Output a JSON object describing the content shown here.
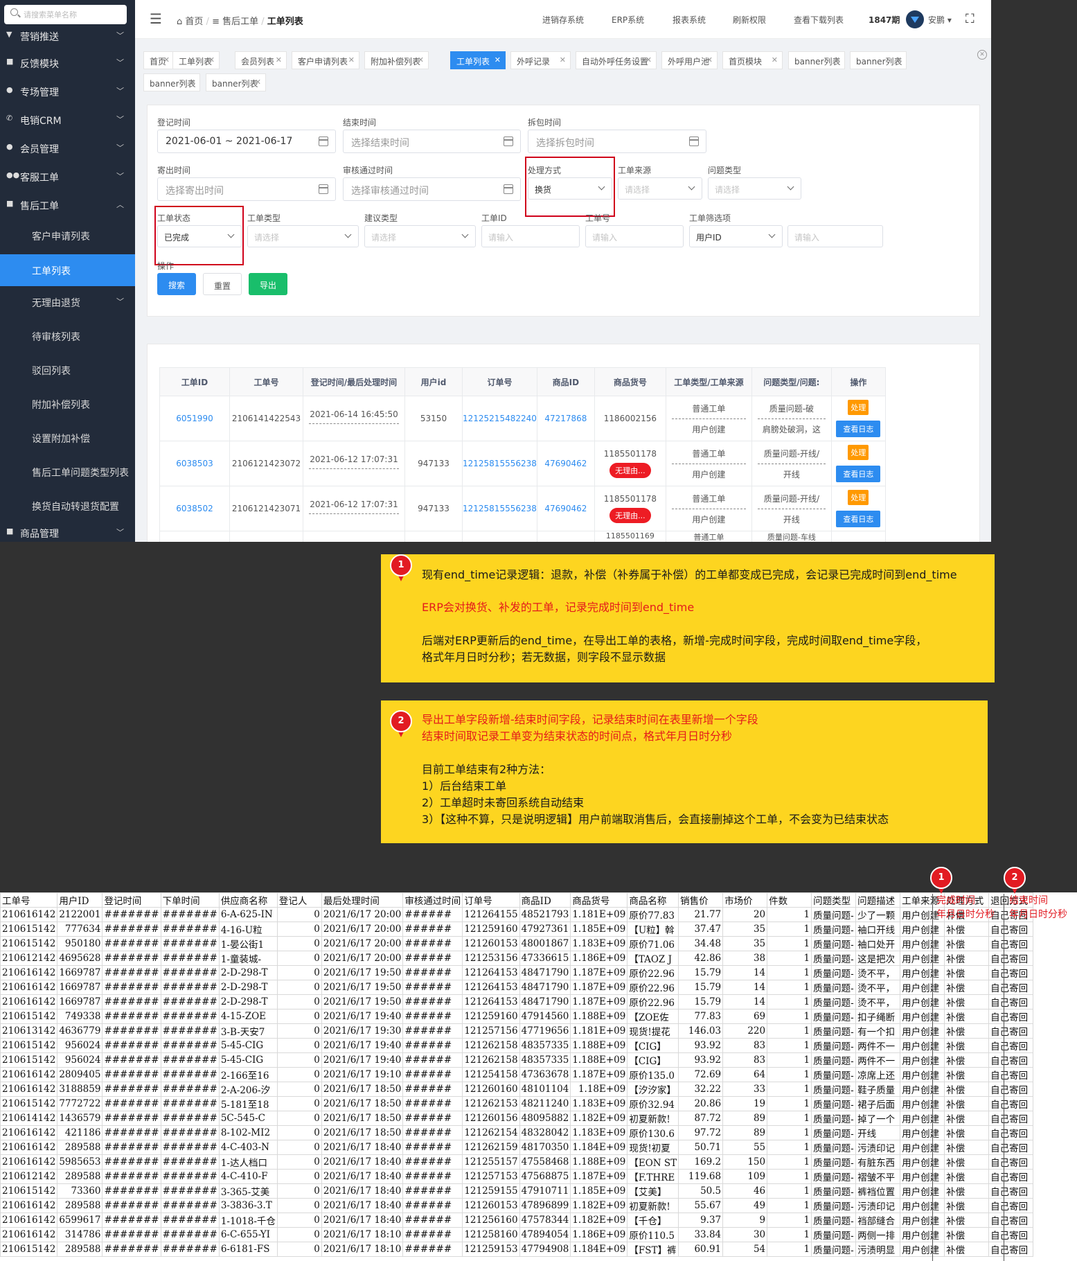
{
  "sidebar": {
    "search_placeholder": "请搜索菜单名称",
    "items": [
      {
        "label": "营销推送",
        "icon": "megaphone-icon"
      },
      {
        "label": "反馈模块",
        "icon": "lock-icon"
      },
      {
        "label": "专场管理",
        "icon": "pin-icon"
      },
      {
        "label": "电销CRM",
        "icon": "phone-icon"
      },
      {
        "label": "会员管理",
        "icon": "user-icon"
      },
      {
        "label": "客服工单",
        "icon": "users-icon"
      },
      {
        "label": "售后工单",
        "icon": "folder-icon"
      }
    ],
    "subitems": [
      "客户申请列表",
      "工单列表",
      "无理由退货",
      "待审核列表",
      "驳回列表",
      "附加补偿列表",
      "设置附加补偿",
      "售后工单问题类型列表",
      "换货自动转退货配置"
    ],
    "last_item": "商品管理"
  },
  "topbar": {
    "breadcrumb": [
      "首页",
      "售后工单",
      "工单列表"
    ],
    "nav": [
      "进销存系统",
      "ERP系统",
      "报表系统",
      "刷新权限",
      "查看下载列表",
      "1847期"
    ],
    "user": "安鹏"
  },
  "tabs": [
    "首页",
    "工单列表",
    "会员列表",
    "客户申请列表",
    "附加补偿列表",
    "工单列表",
    "外呼记录",
    "自动外呼任务设置",
    "外呼用户池",
    "首页模块",
    "banner列表",
    "banner列表",
    "banner列表",
    "banner列表"
  ],
  "filters": {
    "reg_time_label": "登记时间",
    "reg_time_value": "2021-06-01 ~ 2021-06-17",
    "end_time_label": "结束时间",
    "end_time_ph": "选择结束时间",
    "unpack_label": "拆包时间",
    "unpack_ph": "选择拆包时间",
    "ship_label": "寄出时间",
    "ship_ph": "选择寄出时间",
    "audit_label": "审核通过时间",
    "audit_ph": "选择审核通过时间",
    "method_label": "处理方式",
    "method_value": "换货",
    "source_label": "工单来源",
    "source_ph": "请选择",
    "problem_label": "问题类型",
    "problem_ph": "请选择",
    "status_label": "工单状态",
    "status_value": "已完成",
    "type_label": "工单类型",
    "type_ph": "请选择",
    "suggest_label": "建议类型",
    "suggest_ph": "请选择",
    "id_label": "工单ID",
    "id_ph": "请输入",
    "no_label": "工单号",
    "no_ph": "请输入",
    "filter_label": "工单筛选项",
    "filter_value": "用户ID",
    "filter_ph": "请输入",
    "ops_label": "操作",
    "search": "搜索",
    "reset": "重置",
    "export": "导出"
  },
  "table": {
    "headers": [
      "工单ID",
      "工单号",
      "登记时间/最后处理时间",
      "用户id",
      "订单号",
      "商品ID",
      "商品货号",
      "工单类型/工单来源",
      "问题类型/问题:",
      "操作"
    ],
    "rows": [
      {
        "id": "6051990",
        "no": "2106141422543",
        "time": "2021-06-14 16:45:50",
        "uid": "53150",
        "order": "12125215482240",
        "goods": "47217868",
        "sku": "1186002156",
        "badge": "",
        "type": "普通工单",
        "source": "用户创建",
        "problem": "质量问题-破",
        "problem2": "肩膀处破洞，这"
      },
      {
        "id": "6038503",
        "no": "2106121423072",
        "time": "2021-06-12 17:07:31",
        "uid": "947133",
        "order": "12125815556238",
        "goods": "47690462",
        "sku": "1185501178",
        "badge": "无理由...",
        "type": "普通工单",
        "source": "用户创建",
        "problem": "质量问题-开线/",
        "problem2": "开线"
      },
      {
        "id": "6038502",
        "no": "2106121423071",
        "time": "2021-06-12 17:07:31",
        "uid": "947133",
        "order": "12125815556238",
        "goods": "47690462",
        "sku": "1185501178",
        "badge": "无理由...",
        "type": "普通工单",
        "source": "用户创建",
        "problem": "质量问题-开线/",
        "problem2": "开线"
      }
    ],
    "partial_row": {
      "sku": "1185501169",
      "type": "普通工单",
      "problem": "质量问题-车线"
    },
    "btn_handle": "处理",
    "btn_log": "查看日志"
  },
  "note1": {
    "num": "1",
    "l1": "现有end_time记录逻辑：退款，补偿（补券属于补偿）的工单都变成已完成，会记录已完成时间到end_time",
    "l2": "ERP会对换货、补发的工单，记录完成时间到end_time",
    "l3": "后端对ERP更新后的end_time，在导出工单的表格，新增-完成时间字段，完成时间取end_time字段，",
    "l4": "格式年月日时分秒；若无数据，则字段不显示数据"
  },
  "note2": {
    "num": "2",
    "l1": "导出工单字段新增-结束时间字段，记录结束时间在表里新增一个字段",
    "l2": "结束时间取记录工单变为结束状态的时间点，格式年月日时分秒",
    "l3": "目前工单结束有2种方法：",
    "l4": "1）后台结束工单",
    "l5": "2）工单超时未寄回系统自动结束",
    "l6": "3）【这种不算，只是说明逻辑】用户前端取消售后，会直接删掉这个工单，不会变为已结束状态"
  },
  "sheet": {
    "headers": [
      "工单号",
      "用户ID",
      "登记时间",
      "下单时间",
      "供应商名称",
      "登记人",
      "最后处理时间",
      "审核通过时间",
      "订单号",
      "商品ID",
      "商品货号",
      "商品名称",
      "销售价",
      "市场价",
      "件数",
      "问题类型",
      "问题描述",
      "工单来源",
      "处理方式",
      "退回方式"
    ],
    "new_col1": {
      "num": "1",
      "title": "完成时间",
      "fmt": "年月日时分秒"
    },
    "new_col2": {
      "num": "2",
      "title": "结束时间",
      "fmt": "年月日时分秒"
    },
    "rows": [
      [
        "210616142",
        "2122001",
        "#######",
        "#######",
        "6-A-625-IN",
        "0",
        "2021/6/17 20:00",
        "######",
        "121264155",
        "48521793",
        "1.181E+09",
        "原价77.83",
        "21.77",
        "20",
        "1",
        "质量问题-",
        "少了一颗",
        "用户创建",
        "补偿",
        "自己寄回"
      ],
      [
        "210615142",
        "777634",
        "#######",
        "#######",
        "4-16-U粒",
        "0",
        "2021/6/17 20:00",
        "######",
        "121259160",
        "47927361",
        "1.185E+09",
        "【U粒】斡",
        "37.47",
        "35",
        "1",
        "质量问题-",
        "袖口开线",
        "用户创建",
        "补偿",
        "自己寄回"
      ],
      [
        "210615142",
        "950180",
        "#######",
        "#######",
        "1-晏公街1",
        "0",
        "2021/6/17 20:00",
        "######",
        "121260153",
        "48001867",
        "1.183E+09",
        "原价71.06",
        "34.48",
        "35",
        "1",
        "质量问题-",
        "袖口处开",
        "用户创建",
        "补偿",
        "自己寄回"
      ],
      [
        "210612142",
        "4695628",
        "#######",
        "#######",
        "1-童装城-",
        "0",
        "2021/6/17 20:00",
        "######",
        "121253156",
        "47336615",
        "1.186E+09",
        "【TAOZ J",
        "42.86",
        "38",
        "1",
        "质量问题-",
        "这是把次",
        "用户创建",
        "补偿",
        "自己寄回"
      ],
      [
        "210616142",
        "1669787",
        "#######",
        "#######",
        "2-D-298-T",
        "0",
        "2021/6/17 19:50",
        "######",
        "121264153",
        "48471790",
        "1.187E+09",
        "原价22.96",
        "15.79",
        "14",
        "1",
        "质量问题-",
        "烫不平，",
        "用户创建",
        "补偿",
        "自己寄回"
      ],
      [
        "210616142",
        "1669787",
        "#######",
        "#######",
        "2-D-298-T",
        "0",
        "2021/6/17 19:50",
        "######",
        "121264153",
        "48471790",
        "1.187E+09",
        "原价22.96",
        "15.79",
        "14",
        "1",
        "质量问题-",
        "烫不平，",
        "用户创建",
        "补偿",
        "自己寄回"
      ],
      [
        "210616142",
        "1669787",
        "#######",
        "#######",
        "2-D-298-T",
        "0",
        "2021/6/17 19:50",
        "######",
        "121264153",
        "48471790",
        "1.187E+09",
        "原价22.96",
        "15.79",
        "14",
        "1",
        "质量问题-",
        "烫不平，",
        "用户创建",
        "补偿",
        "自己寄回"
      ],
      [
        "210615142",
        "749338",
        "#######",
        "#######",
        "4-15-ZOE",
        "0",
        "2021/6/17 19:40",
        "######",
        "121259160",
        "47914560",
        "1.188E+09",
        "【ZOE佐",
        "77.83",
        "69",
        "1",
        "质量问题-",
        "扣子绳断",
        "用户创建",
        "补偿",
        "自己寄回"
      ],
      [
        "210613142",
        "4636779",
        "#######",
        "#######",
        "3-B-天安7",
        "0",
        "2021/6/17 19:30",
        "######",
        "121257156",
        "47719656",
        "1.181E+09",
        "现货!提花",
        "146.03",
        "220",
        "1",
        "质量问题-",
        "有一个扣",
        "用户创建",
        "补偿",
        "自己寄回"
      ],
      [
        "210615142",
        "956024",
        "#######",
        "#######",
        "5-45-CIG",
        "0",
        "2021/6/17 19:40",
        "######",
        "121262158",
        "48357335",
        "1.188E+09",
        "【CIG】",
        "93.92",
        "83",
        "1",
        "质量问题-",
        "两件不一",
        "用户创建",
        "补偿",
        "自己寄回"
      ],
      [
        "210615142",
        "956024",
        "#######",
        "#######",
        "5-45-CIG",
        "0",
        "2021/6/17 19:40",
        "######",
        "121262158",
        "48357335",
        "1.188E+09",
        "【CIG】",
        "93.92",
        "83",
        "1",
        "质量问题-",
        "两件不一",
        "用户创建",
        "补偿",
        "自己寄回"
      ],
      [
        "210616142",
        "2809405",
        "#######",
        "#######",
        "2-166至16",
        "0",
        "2021/6/17 19:10",
        "######",
        "121254158",
        "47363678",
        "1.187E+09",
        "原价135.0",
        "72.69",
        "64",
        "1",
        "质量问题-",
        "凉席上还",
        "用户创建",
        "补偿",
        "自己寄回"
      ],
      [
        "210616142",
        "3188859",
        "#######",
        "#######",
        "2-A-206-汐",
        "0",
        "2021/6/17 18:50",
        "######",
        "121260160",
        "48101104",
        "1.18E+09",
        "【汐汐家】",
        "32.22",
        "33",
        "1",
        "质量问题-",
        "鞋子质量",
        "用户创建",
        "补偿",
        "自己寄回"
      ],
      [
        "210615142",
        "7772722",
        "#######",
        "#######",
        "5-181至18",
        "0",
        "2021/6/17 18:50",
        "######",
        "121262153",
        "48211240",
        "1.183E+09",
        "原价32.94",
        "20.86",
        "19",
        "1",
        "质量问题-",
        "裙子后面",
        "用户创建",
        "补偿",
        "自己寄回"
      ],
      [
        "210614142",
        "1436579",
        "#######",
        "#######",
        "5C-545-C",
        "0",
        "2021/6/17 18:50",
        "######",
        "121260156",
        "48095882",
        "1.182E+09",
        "初夏新款!",
        "87.72",
        "89",
        "1",
        "质量问题-",
        "掉了一个",
        "用户创建",
        "补偿",
        "自己寄回"
      ],
      [
        "210616142",
        "421186",
        "#######",
        "#######",
        "8-102-MI2",
        "0",
        "2021/6/17 18:50",
        "######",
        "121262154",
        "48328042",
        "1.183E+09",
        "原价130.6",
        "97.72",
        "89",
        "1",
        "质量问题-",
        "开线",
        "用户创建",
        "补偿",
        "自己寄回"
      ],
      [
        "210616142",
        "289588",
        "#######",
        "#######",
        "4-C-403-N",
        "0",
        "2021/6/17 18:40",
        "######",
        "121262159",
        "48170350",
        "1.184E+09",
        "现货!初夏",
        "50.71",
        "55",
        "1",
        "质量问题-",
        "污渍印记",
        "用户创建",
        "补偿",
        "自己寄回"
      ],
      [
        "210616142",
        "5985653",
        "#######",
        "#######",
        "1-达人档口",
        "0",
        "2021/6/17 18:40",
        "######",
        "121255157",
        "47558468",
        "1.188E+09",
        "【EON ST",
        "169.2",
        "150",
        "1",
        "质量问题-",
        "有脏东西",
        "用户创建",
        "补偿",
        "自己寄回"
      ],
      [
        "210612142",
        "289588",
        "#######",
        "#######",
        "4-C-410-F",
        "0",
        "2021/6/17 18:40",
        "######",
        "121257153",
        "47568875",
        "1.187E+09",
        "【F.THRE",
        "119.68",
        "109",
        "1",
        "质量问题-",
        "褶皱不平",
        "用户创建",
        "补偿",
        "自己寄回"
      ],
      [
        "210615142",
        "73360",
        "#######",
        "#######",
        "3-365-艾美",
        "0",
        "2021/6/17 18:40",
        "######",
        "121259155",
        "47910711",
        "1.185E+09",
        "【艾美】",
        "50.5",
        "46",
        "1",
        "质量问题-",
        "裤裆位置",
        "用户创建",
        "补偿",
        "自己寄回"
      ],
      [
        "210616142",
        "289588",
        "#######",
        "#######",
        "3-3836-3.T",
        "0",
        "2021/6/17 18:40",
        "######",
        "121260153",
        "47896899",
        "1.182E+09",
        "初夏新款!",
        "55.67",
        "49",
        "1",
        "质量问题-",
        "污渍印记",
        "用户创建",
        "补偿",
        "自己寄回"
      ],
      [
        "210616142",
        "6599617",
        "#######",
        "#######",
        "1-1018-千仓",
        "0",
        "2021/6/17 18:40",
        "######",
        "121256160",
        "47578344",
        "1.182E+09",
        "【千仓】",
        "9.37",
        "9",
        "1",
        "质量问题-",
        "裆部缝合",
        "用户创建",
        "补偿",
        "自己寄回"
      ],
      [
        "210616142",
        "314786",
        "#######",
        "#######",
        "6-C-655-YI",
        "0",
        "2021/6/17 18:10",
        "######",
        "121258160",
        "47894054",
        "1.186E+09",
        "原价110.5",
        "33.84",
        "30",
        "1",
        "质量问题-",
        "两侧一排",
        "用户创建",
        "补偿",
        "自己寄回"
      ],
      [
        "210615142",
        "289588",
        "#######",
        "#######",
        "6-6181-FS",
        "0",
        "2021/6/17 18:10",
        "######",
        "121259153",
        "47794908",
        "1.184E+09",
        "【FST】裤",
        "60.91",
        "54",
        "1",
        "质量问题-",
        "污渍明显",
        "用户创建",
        "补偿",
        "自己寄回"
      ]
    ]
  }
}
